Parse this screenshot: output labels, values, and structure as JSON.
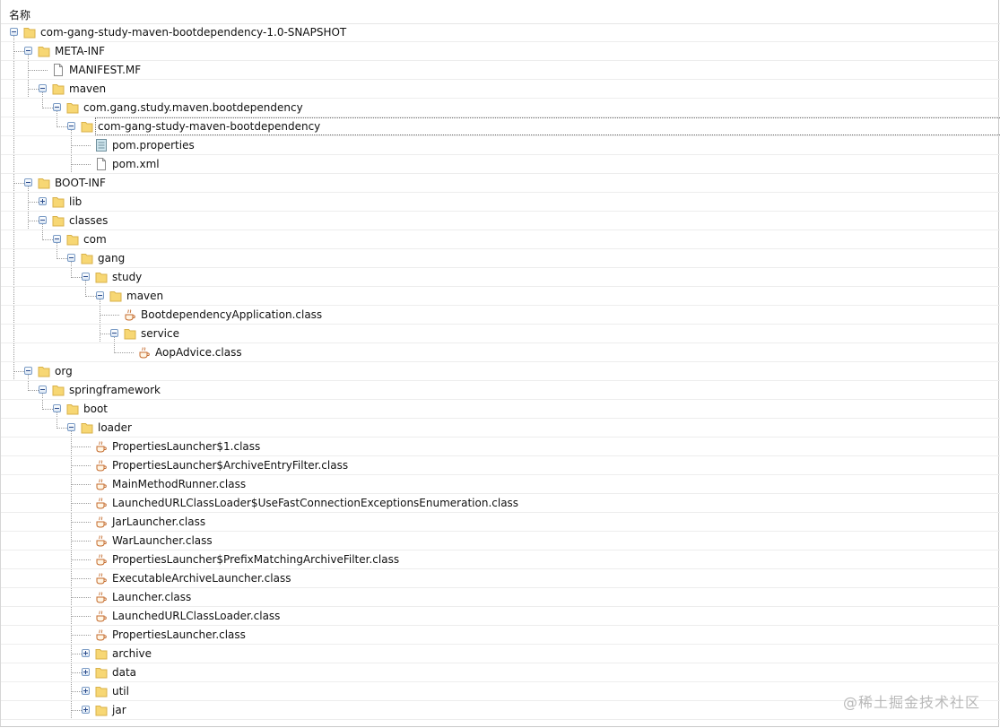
{
  "header": {
    "column_name": "名称"
  },
  "tree": [
    {
      "label": "com-gang-study-maven-bootdependency-1.0-SNAPSHOT",
      "depth": 0,
      "icon": "folder-icon",
      "toggle": "minus",
      "last": false
    },
    {
      "label": "META-INF",
      "depth": 1,
      "icon": "folder-icon",
      "toggle": "minus",
      "last": false
    },
    {
      "label": "MANIFEST.MF",
      "depth": 2,
      "icon": "file-icon",
      "toggle": null,
      "last": false
    },
    {
      "label": "maven",
      "depth": 2,
      "icon": "folder-icon",
      "toggle": "minus",
      "last": true
    },
    {
      "label": "com.gang.study.maven.bootdependency",
      "depth": 3,
      "icon": "folder-icon",
      "toggle": "minus",
      "last": true
    },
    {
      "label": "com-gang-study-maven-bootdependency",
      "depth": 4,
      "icon": "folder-icon",
      "toggle": "minus",
      "last": true,
      "selected": true
    },
    {
      "label": "pom.properties",
      "depth": 5,
      "icon": "properties-file-icon",
      "toggle": null,
      "last": false
    },
    {
      "label": "pom.xml",
      "depth": 5,
      "icon": "file-icon",
      "toggle": null,
      "last": true
    },
    {
      "label": "BOOT-INF",
      "depth": 1,
      "icon": "folder-icon",
      "toggle": "minus",
      "last": false
    },
    {
      "label": "lib",
      "depth": 2,
      "icon": "folder-icon",
      "toggle": "plus",
      "last": false
    },
    {
      "label": "classes",
      "depth": 2,
      "icon": "folder-icon",
      "toggle": "minus",
      "last": true
    },
    {
      "label": "com",
      "depth": 3,
      "icon": "folder-icon",
      "toggle": "minus",
      "last": true
    },
    {
      "label": "gang",
      "depth": 4,
      "icon": "folder-icon",
      "toggle": "minus",
      "last": true
    },
    {
      "label": "study",
      "depth": 5,
      "icon": "folder-icon",
      "toggle": "minus",
      "last": true
    },
    {
      "label": "maven",
      "depth": 6,
      "icon": "folder-icon",
      "toggle": "minus",
      "last": true
    },
    {
      "label": "BootdependencyApplication.class",
      "depth": 7,
      "icon": "java-class-icon",
      "toggle": null,
      "last": false
    },
    {
      "label": "service",
      "depth": 7,
      "icon": "folder-icon",
      "toggle": "minus",
      "last": true
    },
    {
      "label": "AopAdvice.class",
      "depth": 8,
      "icon": "java-class-icon",
      "toggle": null,
      "last": true
    },
    {
      "label": "org",
      "depth": 1,
      "icon": "folder-icon",
      "toggle": "minus",
      "last": true
    },
    {
      "label": "springframework",
      "depth": 2,
      "icon": "folder-icon",
      "toggle": "minus",
      "last": true
    },
    {
      "label": "boot",
      "depth": 3,
      "icon": "folder-icon",
      "toggle": "minus",
      "last": true
    },
    {
      "label": "loader",
      "depth": 4,
      "icon": "folder-icon",
      "toggle": "minus",
      "last": true
    },
    {
      "label": "PropertiesLauncher$1.class",
      "depth": 5,
      "icon": "java-class-icon",
      "toggle": null,
      "last": false
    },
    {
      "label": "PropertiesLauncher$ArchiveEntryFilter.class",
      "depth": 5,
      "icon": "java-class-icon",
      "toggle": null,
      "last": false
    },
    {
      "label": "MainMethodRunner.class",
      "depth": 5,
      "icon": "java-class-icon",
      "toggle": null,
      "last": false
    },
    {
      "label": "LaunchedURLClassLoader$UseFastConnectionExceptionsEnumeration.class",
      "depth": 5,
      "icon": "java-class-icon",
      "toggle": null,
      "last": false
    },
    {
      "label": "JarLauncher.class",
      "depth": 5,
      "icon": "java-class-icon",
      "toggle": null,
      "last": false
    },
    {
      "label": "WarLauncher.class",
      "depth": 5,
      "icon": "java-class-icon",
      "toggle": null,
      "last": false
    },
    {
      "label": "PropertiesLauncher$PrefixMatchingArchiveFilter.class",
      "depth": 5,
      "icon": "java-class-icon",
      "toggle": null,
      "last": false
    },
    {
      "label": "ExecutableArchiveLauncher.class",
      "depth": 5,
      "icon": "java-class-icon",
      "toggle": null,
      "last": false
    },
    {
      "label": "Launcher.class",
      "depth": 5,
      "icon": "java-class-icon",
      "toggle": null,
      "last": false
    },
    {
      "label": "LaunchedURLClassLoader.class",
      "depth": 5,
      "icon": "java-class-icon",
      "toggle": null,
      "last": false
    },
    {
      "label": "PropertiesLauncher.class",
      "depth": 5,
      "icon": "java-class-icon",
      "toggle": null,
      "last": false
    },
    {
      "label": "archive",
      "depth": 5,
      "icon": "folder-icon",
      "toggle": "plus",
      "last": false
    },
    {
      "label": "data",
      "depth": 5,
      "icon": "folder-icon",
      "toggle": "plus",
      "last": false
    },
    {
      "label": "util",
      "depth": 5,
      "icon": "folder-icon",
      "toggle": "plus",
      "last": false
    },
    {
      "label": "jar",
      "depth": 5,
      "icon": "folder-icon",
      "toggle": "plus",
      "last": true
    }
  ],
  "watermark": "@稀土掘金技术社区",
  "colors": {
    "folder": "#f7d774",
    "toggle_border": "#7a9bc5",
    "guide_line": "#9b9b9b"
  }
}
